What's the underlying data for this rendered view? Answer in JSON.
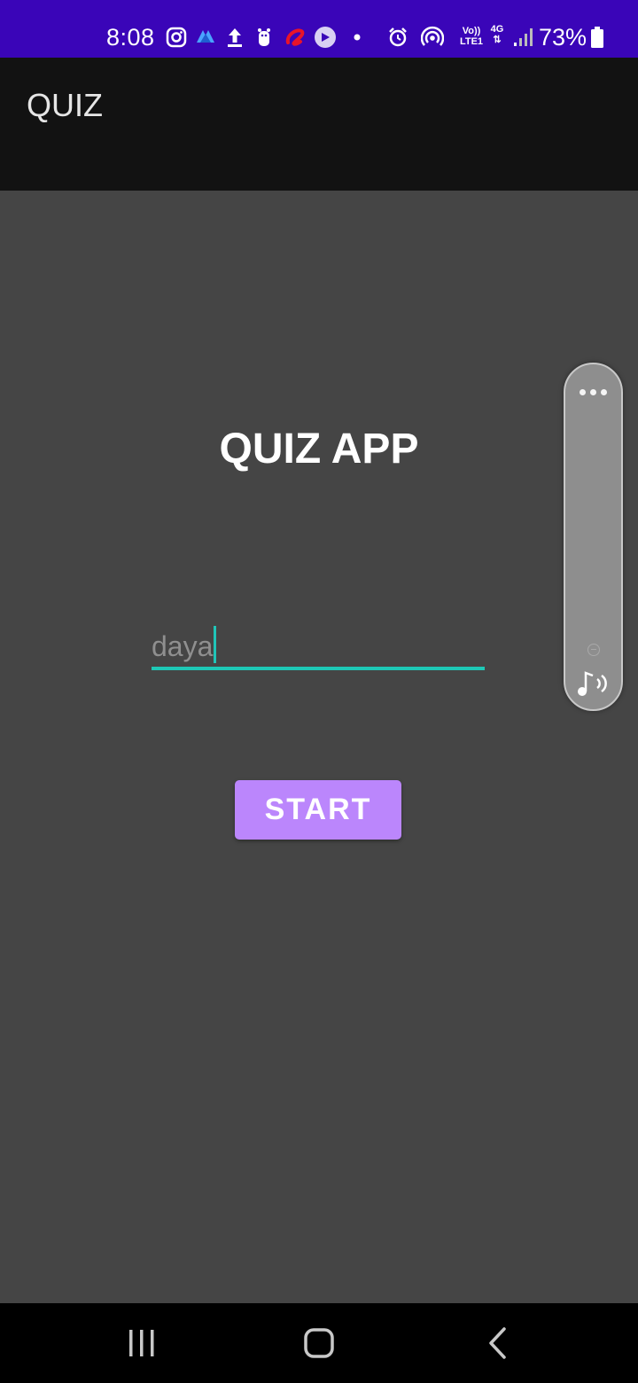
{
  "status_bar": {
    "time": "8:08",
    "network_label_top": "Vo))",
    "network_label_bottom": "LTE1",
    "network_type": "4G",
    "battery": "73%",
    "icons": [
      "instagram-icon",
      "app-notification-icon",
      "upload-icon",
      "teddy-icon",
      "airtel-icon",
      "media-icon",
      "dot-icon",
      "alarm-icon",
      "hotspot-icon",
      "volte-icon",
      "data-arrows-icon",
      "signal-icon",
      "battery-icon"
    ]
  },
  "app_bar": {
    "title": "QUIZ"
  },
  "main": {
    "heading": "QUIZ APP",
    "name_input": {
      "value": "daya"
    },
    "start_button_label": "START"
  },
  "volume_panel": {
    "icons": [
      "more-dots-icon",
      "volume-level-icon",
      "media-volume-icon"
    ]
  },
  "nav_bar": {
    "icons": [
      "recents-icon",
      "home-icon",
      "back-icon"
    ]
  },
  "colors": {
    "status_bar": "#3a05b8",
    "app_bar": "#121212",
    "background": "#454545",
    "accent_underline": "#1ec8b6",
    "button": "#bb86fc"
  }
}
